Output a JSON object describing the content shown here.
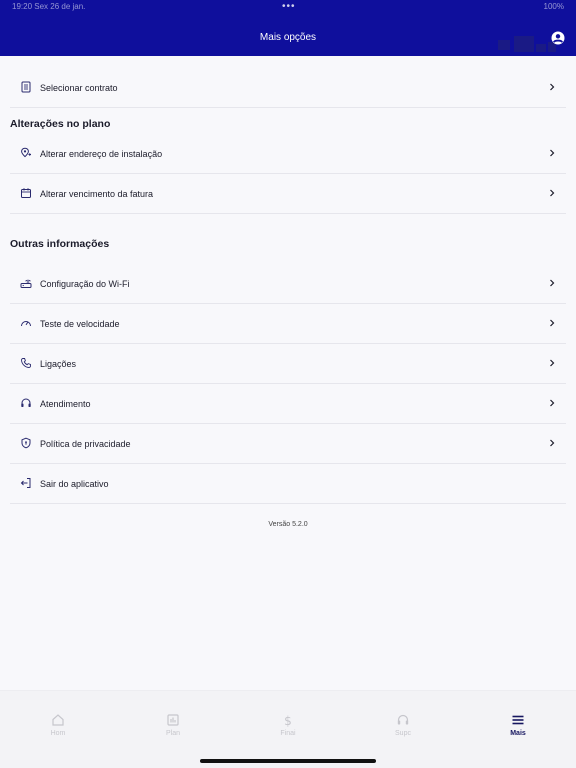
{
  "status_bar": {
    "left": "19:20 Sex 26 de jan.",
    "dots": "•••",
    "right": "100%"
  },
  "header": {
    "title": "Mais opções"
  },
  "menu": {
    "select_contract": "Selecionar contrato",
    "plan_section_title": "Alterações no plano",
    "change_address": "Alterar endereço de instalação",
    "change_due_date": "Alterar vencimento da fatura",
    "other_section_title": "Outras informações",
    "wifi_config": "Configuração do Wi-Fi",
    "speed_test": "Teste de velocidade",
    "calls": "Ligações",
    "support": "Atendimento",
    "privacy_policy": "Política de privacidade",
    "logout": "Sair do aplicativo"
  },
  "version": "Versão 5.2.0",
  "tabbar": {
    "home": "Hom",
    "plan": "Plan",
    "finance": "Finai",
    "support": "Supc",
    "more": "Mais"
  },
  "colors": {
    "header": "#0f0f9c",
    "active_tab": "#161660",
    "inactive_tab": "#c6c6cc"
  },
  "icons": {
    "select_contract": "document-icon",
    "change_address": "location-pin-icon",
    "change_due_date": "calendar-icon",
    "wifi_config": "router-icon",
    "speed_test": "speedometer-icon",
    "calls": "phone-icon",
    "support": "headset-icon",
    "privacy_policy": "shield-icon",
    "logout": "logout-icon"
  }
}
